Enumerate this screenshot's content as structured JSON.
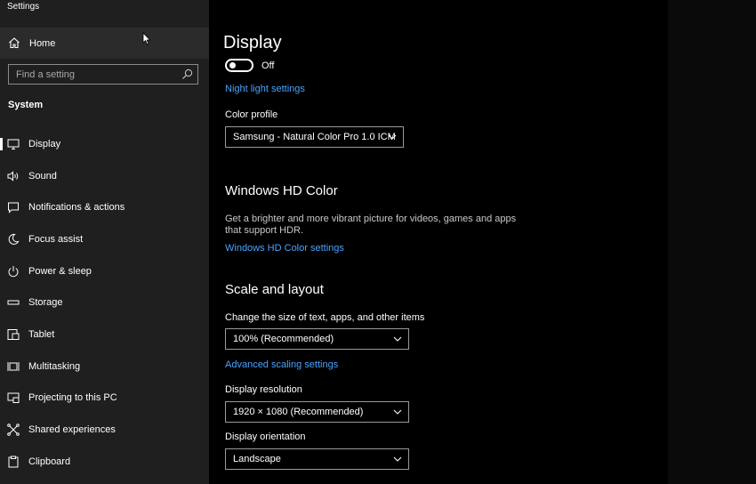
{
  "window": {
    "title": "Settings"
  },
  "sidebar": {
    "home_label": "Home",
    "search_placeholder": "Find a setting",
    "section_label": "System",
    "items": [
      {
        "label": "Display",
        "icon": "monitor-icon"
      },
      {
        "label": "Sound",
        "icon": "speaker-icon"
      },
      {
        "label": "Notifications & actions",
        "icon": "notification-icon"
      },
      {
        "label": "Focus assist",
        "icon": "moon-icon"
      },
      {
        "label": "Power & sleep",
        "icon": "power-icon"
      },
      {
        "label": "Storage",
        "icon": "storage-icon"
      },
      {
        "label": "Tablet",
        "icon": "tablet-icon"
      },
      {
        "label": "Multitasking",
        "icon": "multitasking-icon"
      },
      {
        "label": "Projecting to this PC",
        "icon": "projector-icon"
      },
      {
        "label": "Shared experiences",
        "icon": "shared-icon"
      },
      {
        "label": "Clipboard",
        "icon": "clipboard-icon"
      }
    ]
  },
  "main": {
    "title": "Display",
    "night_light_toggle_state": "Off",
    "night_light_link": "Night light settings",
    "color_profile": {
      "label": "Color profile",
      "value": "Samsung - Natural Color Pro 1.0 ICM"
    },
    "hd_color": {
      "heading": "Windows HD Color",
      "description": "Get a brighter and more vibrant picture for videos, games and apps that support HDR.",
      "link": "Windows HD Color settings"
    },
    "scale_layout": {
      "heading": "Scale and layout",
      "scale_label": "Change the size of text, apps, and other items",
      "scale_value": "100% (Recommended)",
      "advanced_link": "Advanced scaling settings",
      "resolution_label": "Display resolution",
      "resolution_value": "1920 × 1080 (Recommended)",
      "orientation_label": "Display orientation",
      "orientation_value": "Landscape"
    }
  },
  "colors": {
    "sidebar_bg": "#1f1f1f",
    "main_bg": "#000000",
    "link": "#4aa3ff"
  }
}
